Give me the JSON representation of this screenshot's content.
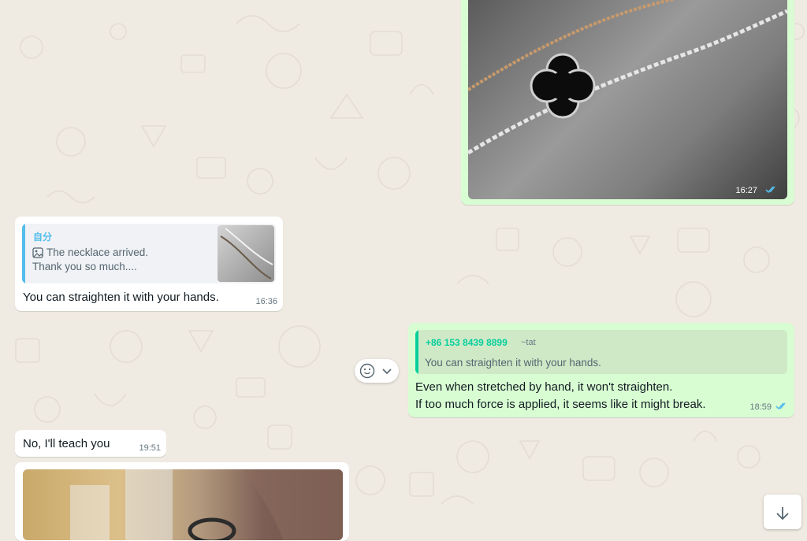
{
  "colors": {
    "wallpaper": "#efeae2",
    "incoming_bubble": "#ffffff",
    "outgoing_bubble": "#d9fdd3",
    "read_ticks": "#53bdeb",
    "quote_incoming_accent": "#53bdeb",
    "quote_outgoing_accent": "#06cf9c",
    "quote_outgoing_sender": "#06cf9c"
  },
  "messages": {
    "m1": {
      "type": "image",
      "direction": "outgoing",
      "time": "16:27",
      "status": "read",
      "image_icon": "necklace-photo"
    },
    "m2": {
      "direction": "incoming",
      "quote": {
        "sender": "自分",
        "text_line1": "The necklace arrived.",
        "text_line2": "Thank you so much....",
        "media_icon": "image-icon"
      },
      "text": "You can straighten it with your hands.",
      "time": "16:36"
    },
    "m3": {
      "direction": "outgoing",
      "quote": {
        "sender": "+86 153 8439 8899",
        "sender_name": "~tat",
        "text": "You can straighten it with your hands."
      },
      "text_line1": "Even when stretched by hand, it won't straighten.",
      "text_line2": "If too much force is applied, it seems like it might break.",
      "time": "18:59",
      "status": "read"
    },
    "m4": {
      "direction": "incoming",
      "text": "No, I'll teach you",
      "time": "19:51"
    },
    "m5": {
      "type": "image",
      "direction": "incoming",
      "image_icon": "hand-with-ring-photo"
    }
  },
  "controls": {
    "reaction_icon": "smiley-icon",
    "menu_icon": "chevron-down-icon",
    "scroll_icon": "arrow-down-icon"
  }
}
